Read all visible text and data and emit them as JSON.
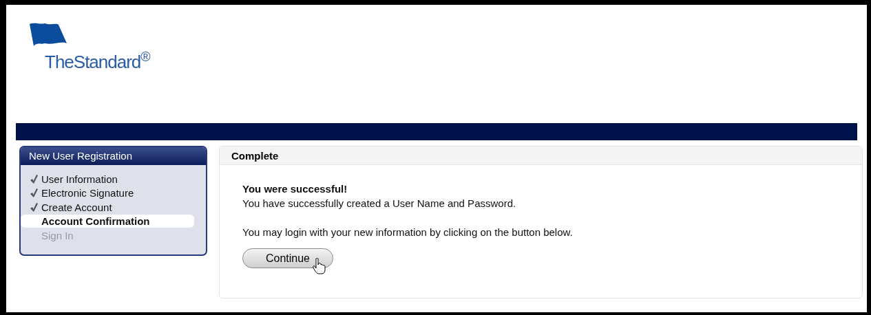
{
  "logo": "TheStandard$^{®}$",
  "sidebar": {
    "title": "New User Registration",
    "steps": [
      {
        "label": "User Information",
        "checked": true,
        "selected": false,
        "disabled": false
      },
      {
        "label": "Electronic Signature",
        "checked": true,
        "selected": false,
        "disabled": false
      },
      {
        "label": "Create Account",
        "checked": true,
        "selected": false,
        "disabled": false
      },
      {
        "label": "Account Confirmation",
        "checked": false,
        "selected": true,
        "disabled": false
      },
      {
        "label": "Sign In",
        "checked": false,
        "selected": false,
        "disabled": true
      }
    ]
  },
  "panel": {
    "title": "Complete",
    "heading": "You were successful!",
    "message": "You have successfully created a User Name and Password.",
    "instruction": "You may login with your new information by clicking on the button below.",
    "button": "Continue"
  }
}
